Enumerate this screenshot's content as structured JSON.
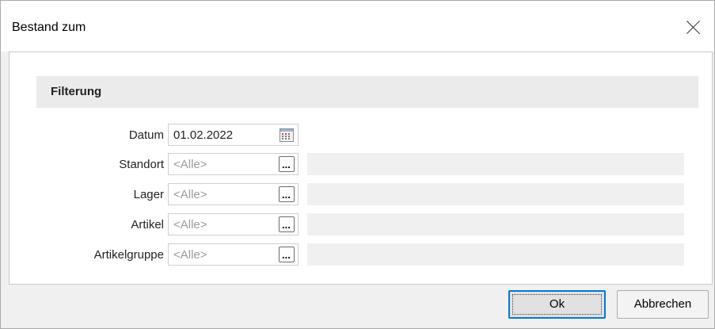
{
  "dialog": {
    "title": "Bestand zum"
  },
  "filter": {
    "group_title": "Filterung",
    "rows": [
      {
        "label": "Datum",
        "value": "01.02.2022",
        "button": "calendar-icon"
      },
      {
        "label": "Standort",
        "placeholder": "<Alle>",
        "button": "ellipsis",
        "button_text": "..."
      },
      {
        "label": "Lager",
        "placeholder": "<Alle>",
        "button": "ellipsis",
        "button_text": "..."
      },
      {
        "label": "Artikel",
        "placeholder": "<Alle>",
        "button": "ellipsis",
        "button_text": "..."
      },
      {
        "label": "Artikelgruppe",
        "placeholder": "<Alle>",
        "button": "ellipsis",
        "button_text": "..."
      }
    ]
  },
  "buttons": {
    "ok": "Ok",
    "cancel": "Abbrechen"
  },
  "colors": {
    "accent": "#0078d7",
    "group_header_bg": "#ebebeb",
    "placeholder_text": "#9a9a9a"
  }
}
